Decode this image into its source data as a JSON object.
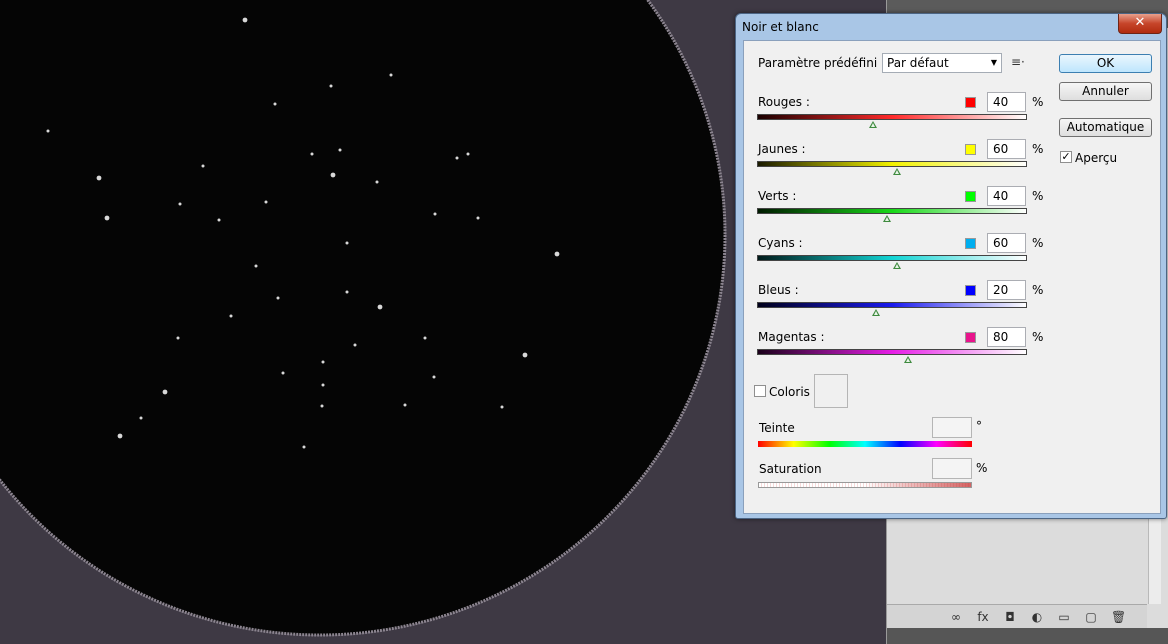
{
  "dialog": {
    "title": "Noir et blanc",
    "close_label": "✕",
    "preset": {
      "label": "Paramètre prédéfini :",
      "value": "Par défaut",
      "menu_icon": "list-menu-icon"
    },
    "sliders": [
      {
        "label": "Rouges :",
        "value": "40",
        "unit": "%",
        "level": 0.43,
        "swatch": "#ff0000",
        "gradient": [
          "#1a0000",
          "#ff2a2a",
          "#ffffff"
        ]
      },
      {
        "label": "Jaunes :",
        "value": "60",
        "unit": "%",
        "level": 0.52,
        "swatch": "#ffff00",
        "gradient": [
          "#1a1a00",
          "#f2f200",
          "#ffffff"
        ]
      },
      {
        "label": "Verts :",
        "value": "40",
        "unit": "%",
        "level": 0.48,
        "swatch": "#00ff00",
        "gradient": [
          "#001a00",
          "#18d818",
          "#ffffff"
        ]
      },
      {
        "label": "Cyans :",
        "value": "60",
        "unit": "%",
        "level": 0.52,
        "swatch": "#00aeef",
        "gradient": [
          "#001a1a",
          "#12d4d4",
          "#ffffff"
        ]
      },
      {
        "label": "Bleus :",
        "value": "20",
        "unit": "%",
        "level": 0.44,
        "swatch": "#0000ff",
        "gradient": [
          "#00001a",
          "#1a1aee",
          "#ffffff"
        ]
      },
      {
        "label": "Magentas :",
        "value": "80",
        "unit": "%",
        "level": 0.56,
        "swatch": "#e8148c",
        "gradient": [
          "#1a001a",
          "#e61ee6",
          "#ffffff"
        ]
      }
    ],
    "tint": {
      "label": "Coloris",
      "checked": false
    },
    "hue": {
      "label": "Teinte",
      "value": "",
      "unit": "°"
    },
    "saturation": {
      "label": "Saturation",
      "value": "",
      "unit": "%"
    },
    "buttons": {
      "ok": "OK",
      "cancel": "Annuler",
      "auto": "Automatique"
    },
    "preview": {
      "label": "Aperçu",
      "checked": true,
      "check_mark": "✓"
    }
  },
  "panel": {
    "toolbar_icons": [
      "link-icon",
      "fx-icon",
      "mask-icon",
      "adjustment-icon",
      "folder-icon",
      "new-layer-icon",
      "trash-icon"
    ],
    "toolbar_glyphs": [
      "∞",
      "fx",
      "◘",
      "◐",
      "▭",
      "▢",
      "🗑"
    ]
  },
  "colors": {
    "accent": "#3c7fb1",
    "dialog_frame": "#a9c6e6",
    "background": "#3e3944"
  }
}
